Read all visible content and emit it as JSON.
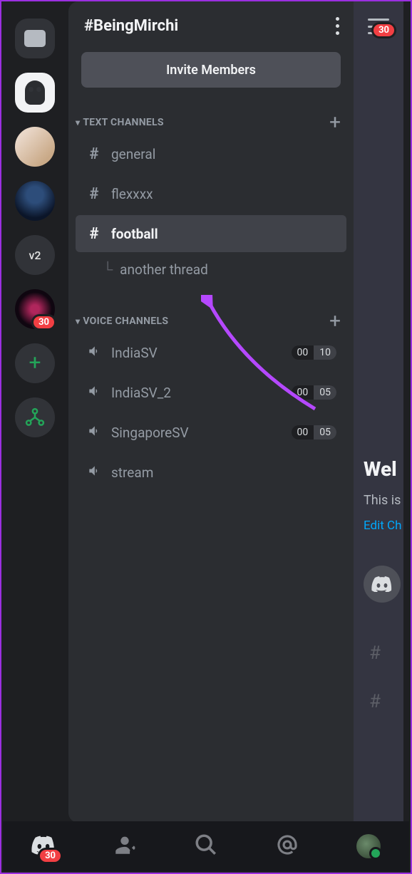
{
  "header": {
    "title": "#BeingMirchi"
  },
  "invite_label": "Invite Members",
  "sections": {
    "text": {
      "label": "TEXT CHANNELS"
    },
    "voice": {
      "label": "VOICE CHANNELS"
    }
  },
  "text_channels": [
    {
      "name": "general",
      "selected": false
    },
    {
      "name": "flexxxx",
      "selected": false
    },
    {
      "name": "football",
      "selected": true
    }
  ],
  "thread": {
    "name": "another thread"
  },
  "voice_channels": [
    {
      "name": "IndiaSV",
      "cur": "00",
      "max": "10"
    },
    {
      "name": "IndiaSV_2",
      "cur": "00",
      "max": "05"
    },
    {
      "name": "SingaporeSV",
      "cur": "00",
      "max": "05"
    },
    {
      "name": "stream",
      "cur": null,
      "max": null
    }
  ],
  "servers": {
    "v2_label": "v2",
    "badge_30": "30"
  },
  "notifications": {
    "inbox": "30",
    "home": "30"
  },
  "sliver": {
    "welcome": "Wel",
    "sub": "This is",
    "edit": "Edit Ch"
  }
}
